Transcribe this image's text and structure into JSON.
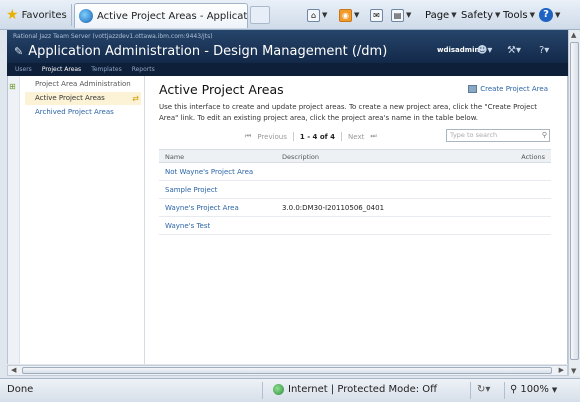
{
  "browser": {
    "favorites_label": "Favorites",
    "tab_title": "Active Project Areas - Application Ad...",
    "commands": {
      "page": "Page",
      "safety": "Safety",
      "tools": "Tools"
    }
  },
  "app": {
    "server_line": "Rational Jazz Team Server (vottjazzdev1.ottawa.ibm.com:9443/jts)",
    "title": "Application Administration - Design Management (/dm)",
    "user": "wdisadmin",
    "nav": [
      "Users",
      "Project Areas",
      "Templates",
      "Reports"
    ],
    "nav_active": "Project Areas"
  },
  "sidebar": {
    "heading": "Project Area Administration",
    "items": [
      {
        "label": "Active Project Areas",
        "active": true
      },
      {
        "label": "Archived Project Areas",
        "active": false
      }
    ]
  },
  "main": {
    "title": "Active Project Areas",
    "create_label": "Create Project Area",
    "description": "Use this interface to create and update project areas. To create a new project area, click the \"Create Project Area\" link. To edit an existing project area, click the project area's name in the table below.",
    "pager": {
      "previous": "Previous",
      "count": "1 - 4 of 4",
      "next": "Next"
    },
    "search_placeholder": "Type to search",
    "columns": {
      "name": "Name",
      "description": "Description",
      "actions": "Actions"
    },
    "rows": [
      {
        "name": "Not Wayne's Project Area",
        "description": ""
      },
      {
        "name": "Sample Project",
        "description": ""
      },
      {
        "name": "Wayne's Project Area",
        "description": "3.0.0:DM30-I20110506_0401"
      },
      {
        "name": "Wayne's Test",
        "description": ""
      }
    ]
  },
  "status": {
    "left": "Done",
    "zone": "Internet | Protected Mode: Off",
    "zoom": "100%"
  }
}
